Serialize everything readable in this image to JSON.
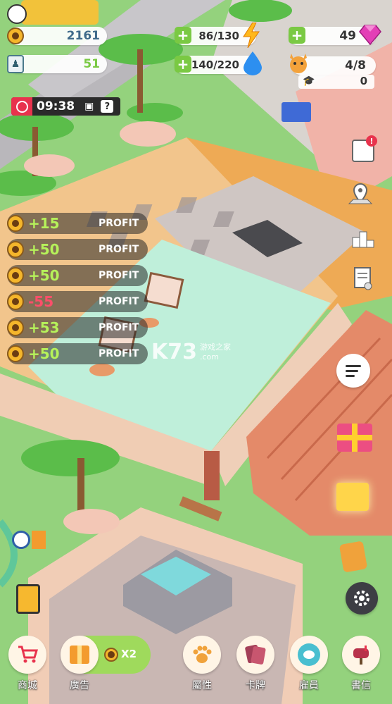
{
  "hud": {
    "coins": "2161",
    "staff": "51",
    "energy": "86/130",
    "water": "140/220",
    "gems": "49",
    "pets": "4/8",
    "graduates": "0",
    "timer": "09:38",
    "help": "?"
  },
  "profits": [
    {
      "amount": "+15",
      "label": "PROFIT",
      "negative": false
    },
    {
      "amount": "+50",
      "label": "PROFIT",
      "negative": false
    },
    {
      "amount": "+50",
      "label": "PROFIT",
      "negative": false
    },
    {
      "amount": "-55",
      "label": "PROFIT",
      "negative": true
    },
    {
      "amount": "+53",
      "label": "PROFIT",
      "negative": false
    },
    {
      "amount": "+50",
      "label": "PROFIT",
      "negative": false
    }
  ],
  "watermark": {
    "logo": "K73",
    "site": "游戏之家",
    "domain": ".com"
  },
  "bottom_nav": {
    "shop": "商城",
    "ads": "廣告",
    "ads_multiplier": "X2",
    "attributes": "屬性",
    "cards": "卡牌",
    "employees": "雇員",
    "mail": "書信"
  },
  "colors": {
    "green_plus": "#7ac943",
    "coin": "#f5b62b",
    "profit_positive": "#b6f25a",
    "profit_negative": "#ff4e6a",
    "timer_bg": "#e8334d"
  }
}
